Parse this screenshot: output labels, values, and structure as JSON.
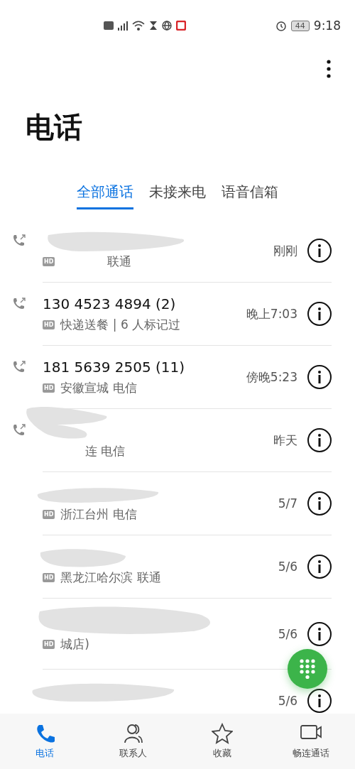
{
  "status_bar": {
    "battery": "44",
    "time": "9:18"
  },
  "title": "电话",
  "tabs": [
    {
      "label": "全部通话",
      "selected": true
    },
    {
      "label": "未接来电",
      "selected": false
    },
    {
      "label": "语音信箱",
      "selected": false
    }
  ],
  "calls": [
    {
      "kind": "partly_hidden",
      "outgoing": true,
      "badge": "HD",
      "location": "联通",
      "time": "刚刚"
    },
    {
      "kind": "plain",
      "number": "130 4523 4894 (2)",
      "outgoing": true,
      "badge": "HD",
      "location": "快递送餐 | 6 人标记过",
      "time": "晚上7:03"
    },
    {
      "kind": "plain",
      "number": "181 5639 2505 (11)",
      "outgoing": true,
      "badge": "HD",
      "location": "安徽宣城 电信",
      "time": "傍晚5:23"
    },
    {
      "kind": "partly_hidden",
      "outgoing": true,
      "location": "连 电信",
      "time": "昨天"
    },
    {
      "kind": "name_hidden",
      "outgoing": false,
      "badge": "HD",
      "location": "浙江台州 电信",
      "time": "5/7"
    },
    {
      "kind": "name_hidden",
      "outgoing": false,
      "badge": "HD",
      "location": "黑龙江哈尔滨 联通",
      "time": "5/6"
    },
    {
      "kind": "name_hidden",
      "outgoing": false,
      "badge": "HD",
      "location": "城店)",
      "time": "5/6"
    },
    {
      "kind": "name_hidden",
      "outgoing": false,
      "time": "5/6"
    }
  ],
  "bottom_nav": [
    {
      "label": "电话",
      "selected": true,
      "kind": "phone"
    },
    {
      "label": "联系人",
      "selected": false,
      "kind": "contacts"
    },
    {
      "label": "收藏",
      "selected": false,
      "kind": "star"
    },
    {
      "label": "畅连通话",
      "selected": false,
      "kind": "video"
    }
  ]
}
